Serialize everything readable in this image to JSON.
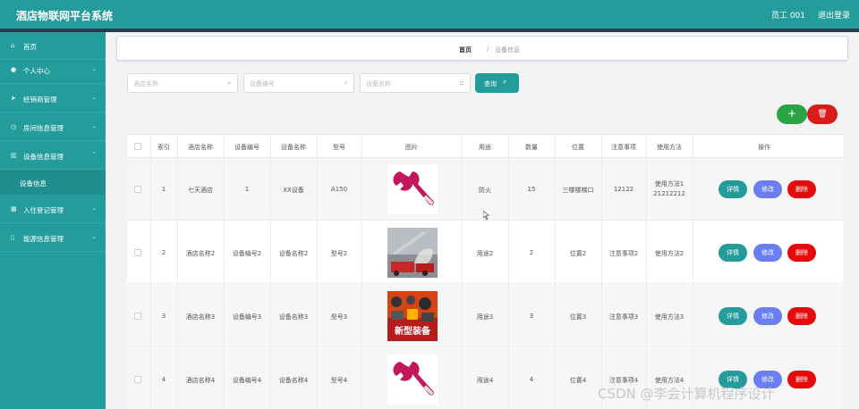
{
  "header": {
    "title": "酒店物联网平台系统",
    "user": "员工 001",
    "logout": "退出登录"
  },
  "sidebar": {
    "items": [
      {
        "label": "首页",
        "icon": "home-icon",
        "has_arrow": false
      },
      {
        "label": "个人中心",
        "icon": "user-icon",
        "has_arrow": true
      },
      {
        "label": "经销商管理",
        "icon": "send-icon",
        "has_arrow": true
      },
      {
        "label": "房间信息管理",
        "icon": "clock-icon",
        "has_arrow": true
      },
      {
        "label": "设备信息管理",
        "icon": "chart-icon",
        "has_arrow": true,
        "expanded": true
      },
      {
        "label": "入住登记管理",
        "icon": "grid-icon",
        "has_arrow": true
      },
      {
        "label": "能源信息管理",
        "icon": "phone-icon",
        "has_arrow": true
      }
    ],
    "sub_item": "设备信息"
  },
  "breadcrumb": {
    "home": "首页",
    "separator": "/",
    "current": "设备信息"
  },
  "search": {
    "hotel_placeholder": "酒店名称",
    "device_no_placeholder": "设备编号",
    "device_name_placeholder": "设备名称",
    "button": "查询"
  },
  "actions": {
    "add": "+",
    "delete_all": "🗑"
  },
  "table": {
    "columns": [
      "索引",
      "酒店名称",
      "设备编号",
      "设备名称",
      "型号",
      "图片",
      "用途",
      "数量",
      "位置",
      "注意事项",
      "使用方法",
      "操作"
    ],
    "rows": [
      {
        "index": "1",
        "hotel": "七天酒店",
        "device_no": "1",
        "device_name": "XX设备",
        "model": "A150",
        "image": "wrench",
        "usage": "防火",
        "qty": "15",
        "location": "三楼楼梯口",
        "notes": "12122",
        "method_line1": "使用方法1",
        "method_line2": "21212212"
      },
      {
        "index": "2",
        "hotel": "酒店名称2",
        "device_no": "设备编号2",
        "device_name": "设备名称2",
        "model": "型号2",
        "image": "fire-truck",
        "usage": "用途2",
        "qty": "2",
        "location": "位置2",
        "notes": "注意事项2",
        "method_line1": "使用方法2",
        "method_line2": ""
      },
      {
        "index": "3",
        "hotel": "酒店名称3",
        "device_no": "设备编号3",
        "device_name": "设备名称3",
        "model": "型号3",
        "image": "equipment-poster",
        "image_caption": "新型装备",
        "usage": "用途3",
        "qty": "3",
        "location": "位置3",
        "notes": "注意事项3",
        "method_line1": "使用方法3",
        "method_line2": ""
      },
      {
        "index": "4",
        "hotel": "酒店名称4",
        "device_no": "设备编号4",
        "device_name": "设备名称4",
        "model": "型号4",
        "image": "wrench",
        "usage": "用途4",
        "qty": "4",
        "location": "位置4",
        "notes": "注意事项4",
        "method_line1": "使用方法4",
        "method_line2": ""
      }
    ],
    "row_buttons": {
      "detail": "详情",
      "edit": "修改",
      "delete": "删除"
    }
  },
  "watermark": "CSDN @李会计算机程序设计",
  "colors": {
    "primary": "#259c9c",
    "edit": "#6a7ef0",
    "delete": "#e60b0b",
    "add": "#2aa347"
  }
}
